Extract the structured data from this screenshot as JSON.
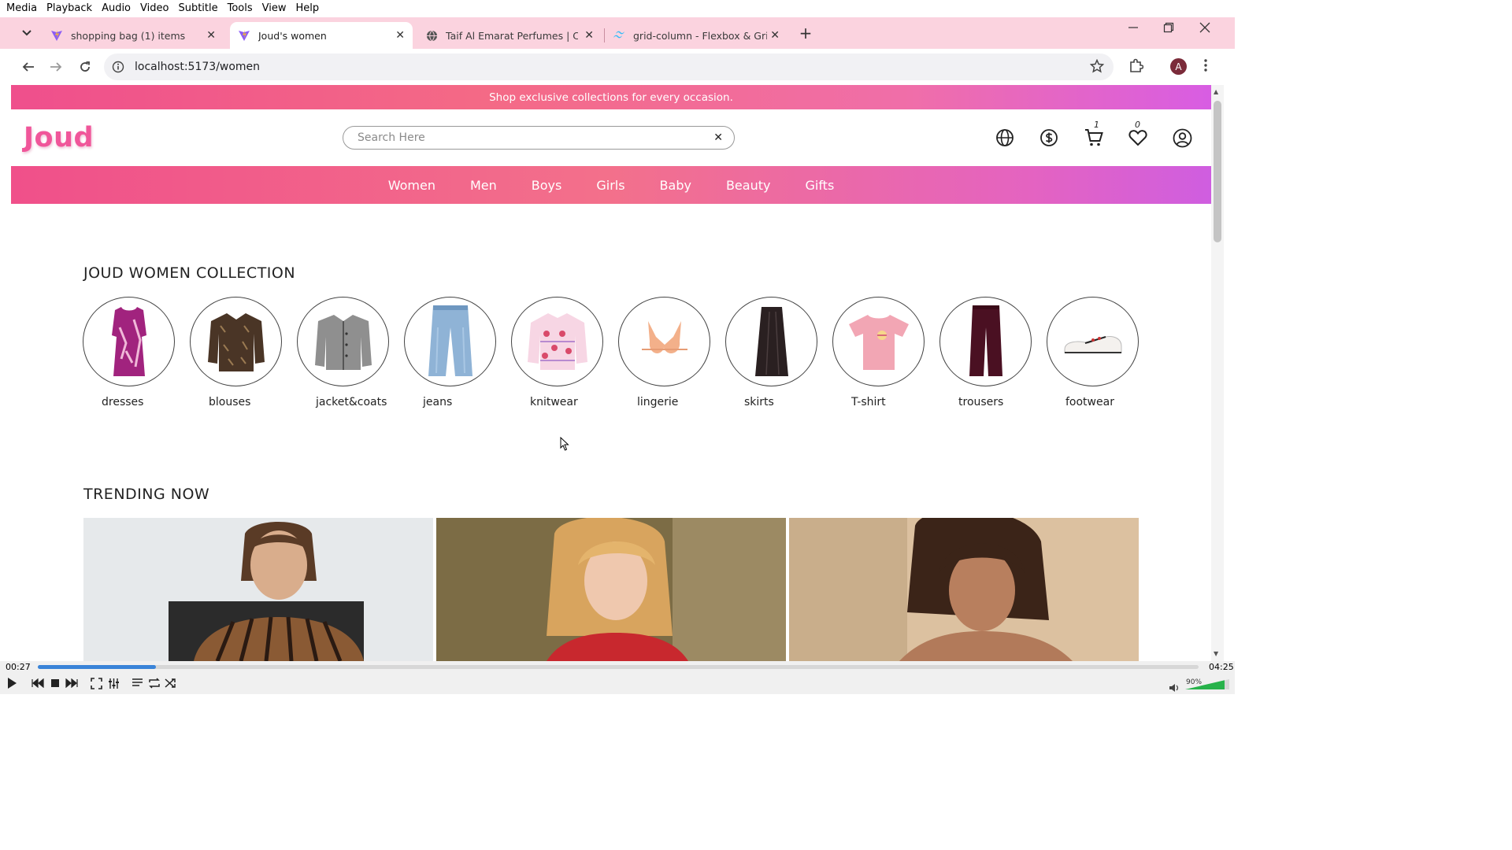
{
  "vlc_menu": [
    "Media",
    "Playback",
    "Audio",
    "Video",
    "Subtitle",
    "Tools",
    "View",
    "Help"
  ],
  "browser": {
    "tabs": [
      {
        "title": "shopping bag (1) items",
        "active": false
      },
      {
        "title": "Joud's women",
        "active": true
      },
      {
        "title": "Taif Al Emarat Perfumes | Contir",
        "active": false
      },
      {
        "title": "grid-column - Flexbox & Grid -",
        "active": false
      }
    ],
    "url": "localhost:5173/women",
    "profile_initial": "A"
  },
  "site": {
    "promo": "Shop exclusive collections for every occasion.",
    "logo": "Joud",
    "search_placeholder": "Search Here",
    "cart_count": "1",
    "wishlist_count": "0",
    "nav": [
      "Women",
      "Men",
      "Boys",
      "Girls",
      "Baby",
      "Beauty",
      "Gifts"
    ],
    "collection_title": "JOUD WOMEN COLLECTION",
    "categories": [
      "dresses",
      "blouses",
      "jacket&coats",
      "jeans",
      "knitwear",
      "lingerie",
      "skirts",
      "T-shirt",
      "trousers",
      "footwear"
    ],
    "trending_title": "TRENDING NOW"
  },
  "player": {
    "elapsed": "00:27",
    "total": "04:25",
    "progress": 0.102,
    "volume": "90%"
  },
  "colors": {
    "brand_pink": "#f0569a",
    "tab_strip": "#fbd3df",
    "seek_fill": "#3a84d8"
  }
}
